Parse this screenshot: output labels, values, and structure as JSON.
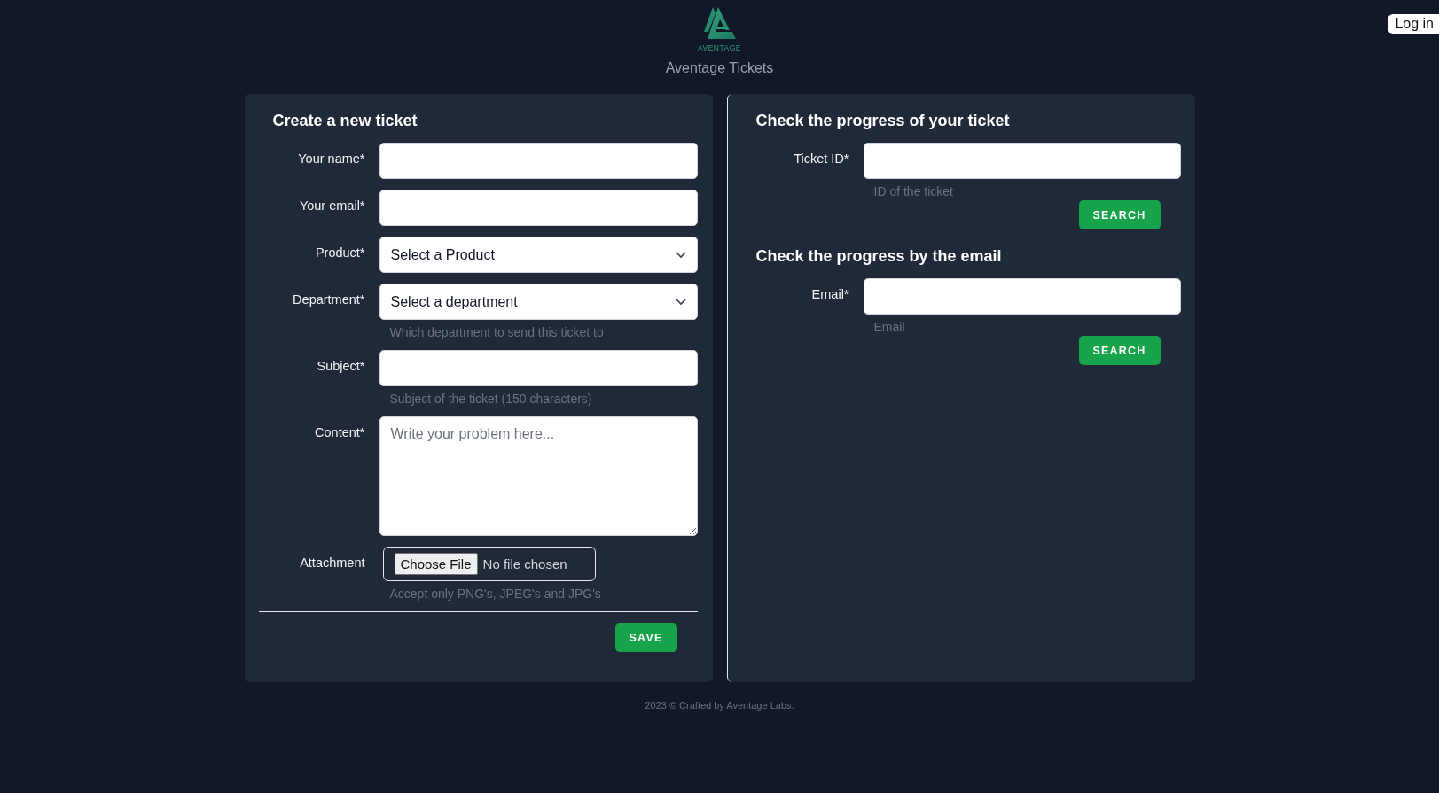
{
  "header": {
    "logo_text": "AVENTAGE",
    "title": "Aventage Tickets",
    "login_button": "Log in"
  },
  "create_ticket": {
    "heading": "Create a new ticket",
    "fields": [
      {
        "kind": "text",
        "label": "Your name*"
      },
      {
        "kind": "text",
        "label": "Your email*"
      },
      {
        "kind": "select",
        "label": "Product*",
        "value": "Select a Product"
      },
      {
        "kind": "select",
        "label": "Department*",
        "value": "Select a department",
        "hint": "Which department to send this ticket to"
      },
      {
        "kind": "text",
        "label": "Subject*",
        "hint": "Subject of the ticket (150 characters)"
      },
      {
        "kind": "textarea",
        "label": "Content*",
        "placeholder": "Write your problem here..."
      },
      {
        "kind": "file",
        "label": "Attachment",
        "button": "Choose File",
        "value": "No file chosen",
        "hint": "Accept only PNG's, JPEG's and JPG's"
      }
    ],
    "save_button": "SAVE"
  },
  "check_progress": [
    {
      "heading": "Check the progress of your ticket",
      "label": "Ticket ID*",
      "hint": "ID of the ticket",
      "button": "SEARCH"
    },
    {
      "heading": "Check the progress by the email",
      "label": "Email*",
      "hint": "Email",
      "button": "SEARCH"
    }
  ],
  "footer": "2023 © Crafted by Aventage Labs."
}
